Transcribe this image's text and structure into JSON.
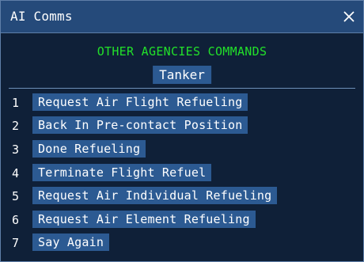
{
  "window": {
    "title": "AI Comms",
    "close_label": "✕"
  },
  "header": {
    "section_title": "OTHER AGENCIES COMMANDS",
    "category": "Tanker"
  },
  "commands": [
    {
      "number": "1",
      "label": "Request Air Flight Refueling"
    },
    {
      "number": "2",
      "label": "Back In Pre-contact Position"
    },
    {
      "number": "3",
      "label": "Done Refueling"
    },
    {
      "number": "4",
      "label": "Terminate Flight Refuel"
    },
    {
      "number": "5",
      "label": "Request Air Individual Refueling"
    },
    {
      "number": "6",
      "label": "Request Air Element Refueling"
    },
    {
      "number": "7",
      "label": "Say Again"
    }
  ],
  "colors": {
    "titlebar": "#254a7a",
    "background": "#0f2038",
    "highlight": "#2c5a92",
    "header_text": "#22e02a",
    "text": "#ffffff"
  }
}
